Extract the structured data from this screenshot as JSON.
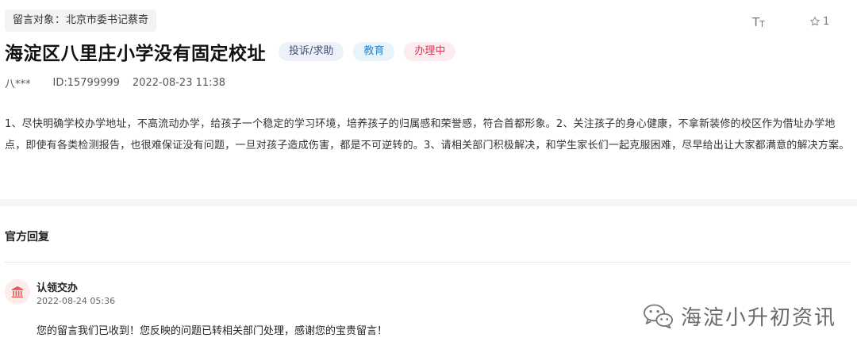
{
  "header": {
    "recipient_label": "留言对象",
    "recipient_sep": "：",
    "recipient_value": "北京市委书记蔡奇",
    "font_toggle_big": "T",
    "font_toggle_small": "T",
    "like_count": "1"
  },
  "post": {
    "title": "海淀区八里庄小学没有固定校址",
    "tags": {
      "type": "投诉/求助",
      "category": "教育",
      "status": "办理中"
    },
    "author": "八***",
    "id": "ID:15799999",
    "datetime": "2022-08-23 11:38",
    "content": "1、尽快明确学校办学地址，不高流动办学，给孩子一个稳定的学习环境，培养孩子的归属感和荣誉感，符合首都形象。2、关注孩子的身心健康，不拿新装修的校区作为借址办学地点，即使有各类检测报告，也很难保证没有问题，一旦对孩子造成伤害，都是不可逆转的。3、请相关部门积极解决，和学生家长们一起克服困难，尽早给出让大家都满意的解决方案。"
  },
  "reply": {
    "section_title": "官方回复",
    "unit": "认领交办",
    "time": "2022-08-24 05:36",
    "text": "您的留言我们已收到！您反映的问题已转相关部门处理，感谢您的宝贵留言！"
  },
  "watermark": {
    "text": "海淀小升初资讯"
  },
  "colors": {
    "status_red": "#e0344c",
    "category_blue": "#2f86c6",
    "type_navy": "#3f5176"
  },
  "icons": {
    "font_size": "font-size-icon",
    "like": "star-icon",
    "avatar": "government-building-icon",
    "watermark": "wechat-icon"
  }
}
